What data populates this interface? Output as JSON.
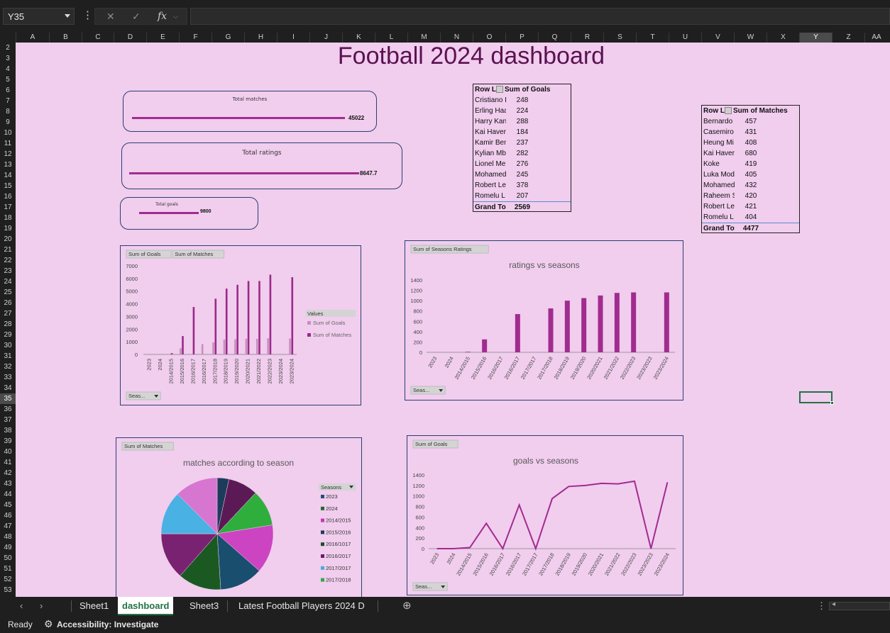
{
  "namebox": {
    "value": "Y35"
  },
  "formula_bar": {
    "fx_label": "fx",
    "cancel_icon": "✕",
    "enter_icon": "✓",
    "value": ""
  },
  "columns": [
    "A",
    "B",
    "C",
    "D",
    "E",
    "F",
    "G",
    "H",
    "I",
    "J",
    "K",
    "L",
    "M",
    "N",
    "O",
    "P",
    "Q",
    "R",
    "S",
    "T",
    "U",
    "V",
    "W",
    "X",
    "Y",
    "Z",
    "AA"
  ],
  "selected_column": "Y",
  "rows": [
    2,
    3,
    4,
    5,
    6,
    7,
    8,
    9,
    10,
    11,
    12,
    13,
    14,
    15,
    16,
    17,
    18,
    19,
    20,
    21,
    22,
    23,
    24,
    25,
    26,
    27,
    28,
    29,
    30,
    31,
    32,
    33,
    34,
    35,
    36,
    37,
    38,
    39,
    40,
    41,
    42,
    43,
    44,
    45,
    46,
    47,
    48,
    49,
    50,
    51,
    52,
    53
  ],
  "selected_row": 35,
  "dashboard": {
    "title": "Football 2024 dashboard",
    "kpis": {
      "matches": {
        "label": "Total matches",
        "value": "45022"
      },
      "ratings": {
        "label": "Total ratings",
        "value": "8647.7"
      },
      "goals": {
        "label": "Total goals",
        "value": "9800"
      }
    },
    "pivot_goals": {
      "headers": [
        "Row La",
        "Sum of Goals"
      ],
      "rows": [
        [
          "Cristiano R",
          "248"
        ],
        [
          "Erling Haa",
          "224"
        ],
        [
          "Harry Kane",
          "288"
        ],
        [
          "Kai Havert",
          "184"
        ],
        [
          "Kamir Ben",
          "237"
        ],
        [
          "Kylian Mb",
          "282"
        ],
        [
          "Lionel Me",
          "276"
        ],
        [
          "Mohamed",
          "245"
        ],
        [
          "Robert Lev",
          "378"
        ],
        [
          "Romelu L",
          "207"
        ]
      ],
      "total": [
        "Grand Tot",
        "2569"
      ]
    },
    "pivot_matches": {
      "headers": [
        "Row La",
        "Sum of Matches"
      ],
      "rows": [
        [
          "Bernardo S",
          "457"
        ],
        [
          "Casemiro",
          "431"
        ],
        [
          "Heung Mi",
          "408"
        ],
        [
          "Kai Havert",
          "680"
        ],
        [
          "Koke",
          "419"
        ],
        [
          "Luka Mod",
          "405"
        ],
        [
          "Mohamed",
          "432"
        ],
        [
          "Raheem S",
          "420"
        ],
        [
          "Robert Lev",
          "421"
        ],
        [
          "Romelu L",
          "404"
        ]
      ],
      "total": [
        "Grand Tot",
        "4477"
      ]
    }
  },
  "chart_data": [
    {
      "type": "bar",
      "title": "",
      "field_buttons": [
        "Sum of Goals",
        "Sum of Matches"
      ],
      "axis_button": "Seas...",
      "legend_title": "Values",
      "categories": [
        "2023",
        "2024",
        "2014/2015",
        "2015/2016",
        "2016/2017",
        "2016/2017",
        "2017/2018",
        "2018/2019",
        "2019/2020",
        "2020/2021",
        "2021/2022",
        "2022/2023",
        "2023/2024",
        "2023/2024"
      ],
      "series": [
        {
          "name": "Sum of Goals",
          "color": "#c98dc0",
          "values": [
            0,
            0,
            20,
            480,
            0,
            820,
            950,
            1180,
            1200,
            1240,
            1230,
            1280,
            0,
            1260
          ]
        },
        {
          "name": "Sum of Matches",
          "color": "#9b2a88",
          "values": [
            0,
            0,
            100,
            1450,
            3750,
            0,
            4400,
            5200,
            5500,
            5800,
            5800,
            6300,
            0,
            6100
          ]
        }
      ],
      "yticks": [
        "0",
        "1000",
        "2000",
        "3000",
        "4000",
        "5000",
        "6000",
        "7000"
      ],
      "ylim": [
        0,
        7000
      ]
    },
    {
      "type": "bar",
      "title": "ratings vs seasons",
      "field_buttons": [
        "Sum of Seasons Ratings"
      ],
      "axis_button": "Seas...",
      "categories": [
        "2023",
        "2024",
        "2014/2015",
        "2015/2016",
        "2016/2017",
        "2016/2017",
        "2017/2017",
        "2017/2018",
        "2018/2019",
        "2019/2020",
        "2020/2021",
        "2021/2022",
        "2022/2023",
        "2023/2023",
        "2023/2024"
      ],
      "series": [
        {
          "name": "",
          "color": "#a12c8f",
          "values": [
            0,
            0,
            10,
            250,
            0,
            740,
            0,
            850,
            1000,
            1050,
            1100,
            1150,
            1160,
            0,
            1160
          ]
        }
      ],
      "yticks": [
        "0",
        "200",
        "400",
        "600",
        "800",
        "1000",
        "1200",
        "1400"
      ],
      "ylim": [
        0,
        1400
      ]
    },
    {
      "type": "pie",
      "title": "matches according to season",
      "field_buttons": [
        "Sum of Matches"
      ],
      "legend_title": "Seasons",
      "legend": [
        {
          "label": "2023",
          "color": "#2a4d7a"
        },
        {
          "label": "2024",
          "color": "#1e6b2f"
        },
        {
          "label": "2014/2015",
          "color": "#c43ab4"
        },
        {
          "label": "2015/2016",
          "color": "#1d3b5a"
        },
        {
          "label": "2016/1017",
          "color": "#1b4e2a"
        },
        {
          "label": "2016/2017",
          "color": "#6a1e60"
        },
        {
          "label": "2017/2017",
          "color": "#4fa7d8"
        },
        {
          "label": "2017/2018",
          "color": "#2fa84a"
        }
      ],
      "slices": [
        {
          "value": 3.4,
          "color": "#1d3b5a"
        },
        {
          "value": 8.6,
          "color": "#5b1a55"
        },
        {
          "value": 10.5,
          "color": "#2fae3e"
        },
        {
          "value": 14.0,
          "color": "#cc44c2"
        },
        {
          "value": 12.5,
          "color": "#1a4e6e"
        },
        {
          "value": 12.5,
          "color": "#1a5a22"
        },
        {
          "value": 13.5,
          "color": "#7a2272"
        },
        {
          "value": 12.5,
          "color": "#4ab1e4"
        },
        {
          "value": 12.5,
          "color": "#d676d0"
        }
      ]
    },
    {
      "type": "line",
      "title": "goals vs seasons",
      "field_buttons": [
        "Sum of Goals"
      ],
      "axis_button": "Seas...",
      "categories": [
        "2023",
        "2024",
        "2014/2015",
        "2015/2016",
        "2016/2017",
        "2016/2017",
        "2017/2017",
        "2017/2018",
        "2018/2019",
        "2019/2020",
        "2020/2021",
        "2021/2022",
        "2022/2023",
        "2023/2023",
        "2023/2024"
      ],
      "series": [
        {
          "name": "",
          "color": "#a12c8f",
          "values": [
            0,
            0,
            20,
            480,
            0,
            830,
            0,
            950,
            1180,
            1200,
            1240,
            1230,
            1280,
            0,
            1260
          ]
        }
      ],
      "yticks": [
        "0",
        "200",
        "400",
        "600",
        "800",
        "1000",
        "1200",
        "1400"
      ],
      "ylim": [
        0,
        1400
      ]
    }
  ],
  "sheet_tabs": [
    "Sheet1",
    "dashboard",
    "Sheet3",
    "Latest Football  Players 2024 D"
  ],
  "active_tab": "dashboard",
  "status": {
    "ready": "Ready",
    "accessibility": "Accessibility: Investigate"
  }
}
